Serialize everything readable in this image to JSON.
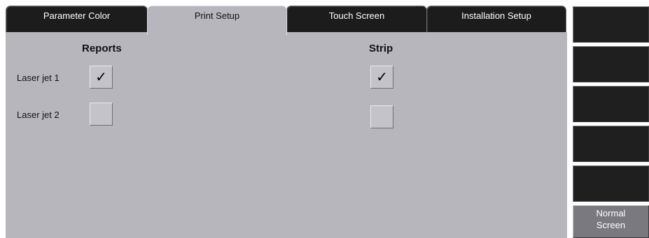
{
  "tabs": [
    {
      "label": "Parameter Color",
      "active": false
    },
    {
      "label": "Print Setup",
      "active": true
    },
    {
      "label": "Touch Screen",
      "active": false
    },
    {
      "label": "Installation Setup",
      "active": false
    }
  ],
  "columns": {
    "reports": "Reports",
    "strip": "Strip"
  },
  "rows": [
    {
      "label": "Laser jet  1",
      "reports_checked": true,
      "strip_checked": true,
      "check_glyph": "✓"
    },
    {
      "label": "Laser jet  2",
      "reports_checked": false,
      "strip_checked": false,
      "check_glyph": ""
    }
  ],
  "sidebar": {
    "normal_screen_line1": "Normal",
    "normal_screen_line2": "Screen"
  },
  "colors": {
    "panel": "#b7b6bd",
    "tab_inactive": "#1c1c1c",
    "side_button": "#1f1f1f",
    "normal_button": "#7a797f"
  }
}
